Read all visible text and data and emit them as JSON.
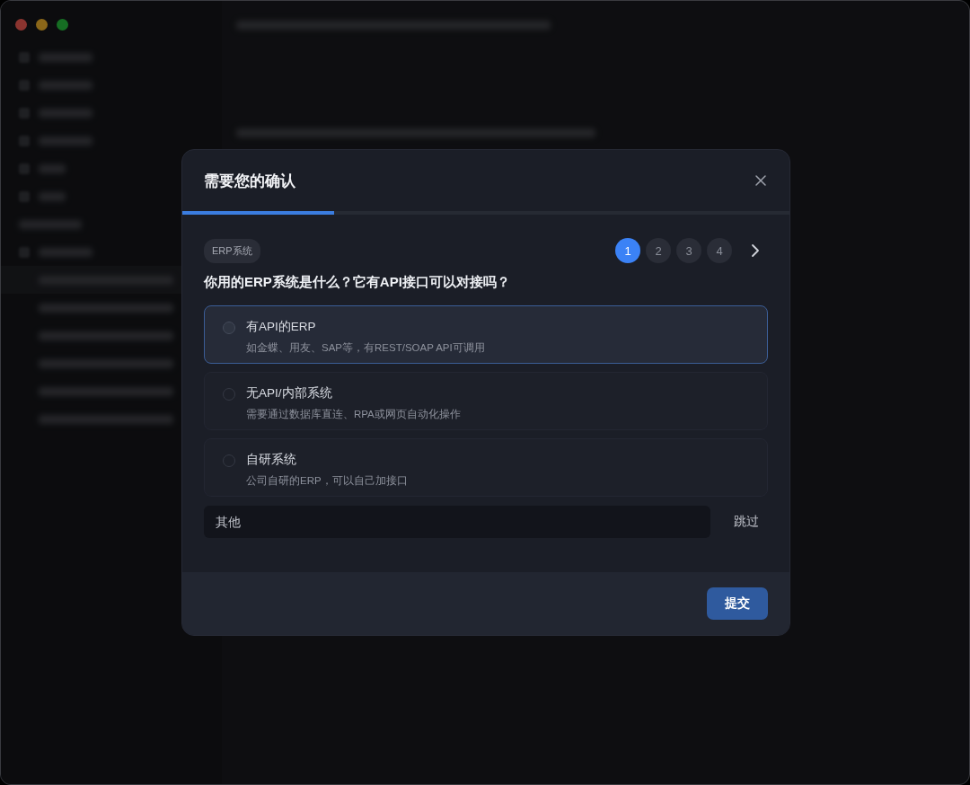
{
  "dialog": {
    "title": "需要您的确认",
    "progress": {
      "level": 0.25
    },
    "tag": "ERP系统",
    "steps": [
      {
        "label": "1",
        "selected": true
      },
      {
        "label": "2",
        "selected": false
      },
      {
        "label": "3",
        "selected": false
      },
      {
        "label": "4",
        "selected": false
      }
    ],
    "question": "你用的ERP系统是什么？它有API接口可以对接吗？",
    "options": [
      {
        "label": "有API的ERP",
        "description": "如金蝶、用友、SAP等，有REST/SOAP API可调用",
        "selected": true
      },
      {
        "label": "无API/内部系统",
        "description": "需要通过数据库直连、RPA或网页自动化操作",
        "selected": false
      },
      {
        "label": "自研系统",
        "description": "公司自研的ERP，可以自己加接口",
        "selected": false
      }
    ],
    "other": {
      "placeholder": "其他"
    },
    "skip": "跳过",
    "submit": "提交"
  }
}
